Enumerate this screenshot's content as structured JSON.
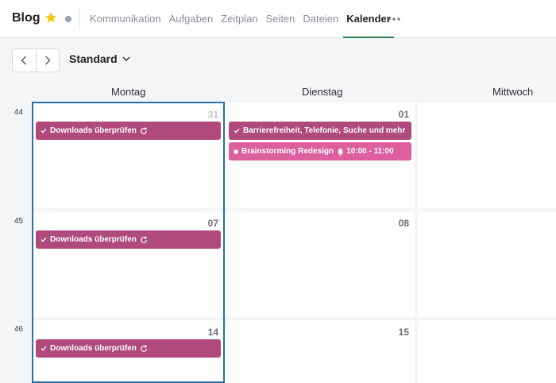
{
  "header": {
    "title": "Blog",
    "star_color": "#f5c518",
    "status_dot_color": "#9aa3b8",
    "nav": [
      {
        "label": "Kommunikation",
        "active": false
      },
      {
        "label": "Aufgaben",
        "active": false
      },
      {
        "label": "Zeitplan",
        "active": false
      },
      {
        "label": "Seiten",
        "active": false
      },
      {
        "label": "Dateien",
        "active": false
      },
      {
        "label": "Kalender",
        "active": true
      }
    ],
    "more_icon": "more-horizontal-icon"
  },
  "toolbar": {
    "prev_icon": "chevron-left-icon",
    "next_icon": "chevron-right-icon",
    "view_label": "Standard"
  },
  "calendar": {
    "days": [
      "Montag",
      "Dienstag",
      "Mittwoch"
    ],
    "weeks": [
      {
        "number": "44",
        "dates": [
          "31",
          "01",
          ""
        ]
      },
      {
        "number": "45",
        "dates": [
          "07",
          "08",
          ""
        ]
      },
      {
        "number": "46",
        "dates": [
          "14",
          "15",
          ""
        ]
      }
    ],
    "events": [
      {
        "week": 0,
        "day": 0,
        "label": "Downloads überprüfen",
        "time": "",
        "kind": "task",
        "recurring": true,
        "alarm": false,
        "color": "#b04a7c"
      },
      {
        "week": 0,
        "day": 1,
        "label": "Barrierefreiheit, Telefonie, Suche und mehr",
        "time": "",
        "kind": "task",
        "recurring": false,
        "alarm": false,
        "color": "#b04a7c"
      },
      {
        "week": 0,
        "day": 1,
        "label": "Brainstorming Redesign",
        "time": "10:00 - 11:00",
        "kind": "appointment",
        "recurring": false,
        "alarm": true,
        "color": "#dd5f9e"
      },
      {
        "week": 1,
        "day": 0,
        "label": "Downloads überprüfen",
        "time": "",
        "kind": "task",
        "recurring": true,
        "alarm": false,
        "color": "#b04a7c"
      },
      {
        "week": 2,
        "day": 0,
        "label": "Downloads überprüfen",
        "time": "",
        "kind": "task",
        "recurring": true,
        "alarm": false,
        "color": "#b04a7c"
      }
    ]
  }
}
